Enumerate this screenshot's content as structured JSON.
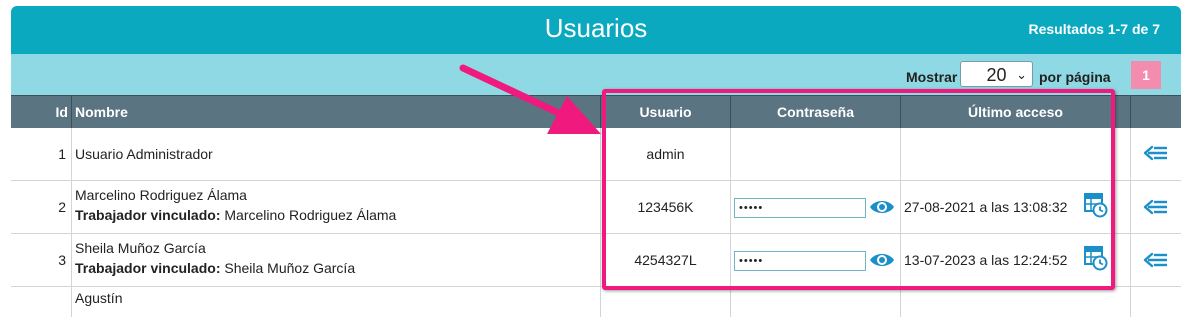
{
  "header": {
    "title": "Usuarios",
    "results": "Resultados 1-7 de 7"
  },
  "toolbar": {
    "show_label": "Mostrar",
    "page_size": "20",
    "per_page_label": "por página",
    "current_page": "1"
  },
  "columns": [
    "Id",
    "Nombre",
    "Usuario",
    "Contraseña",
    "Último acceso"
  ],
  "rows": [
    {
      "id": "1",
      "name": "Usuario Administrador",
      "worker_label": "",
      "worker_name": "",
      "username": "admin",
      "password": "",
      "last_access": ""
    },
    {
      "id": "2",
      "name": "Marcelino Rodriguez Álama",
      "worker_label": "Trabajador vinculado:",
      "worker_name": "Marcelino Rodriguez Álama",
      "username": "123456K",
      "password": "•••••",
      "last_access": "27-08-2021 a las 13:08:32"
    },
    {
      "id": "3",
      "name": "Sheila Muñoz García",
      "worker_label": "Trabajador vinculado:",
      "worker_name": "Sheila Muñoz García",
      "username": "4254327L",
      "password": "•••••",
      "last_access": "13-07-2023 a las 12:24:52"
    },
    {
      "id": "",
      "name": "Agustín",
      "worker_label": "",
      "worker_name": "",
      "username": "",
      "password": "",
      "last_access": ""
    }
  ],
  "colors": {
    "header_bg": "#0aa9bf",
    "toolbar_bg": "#8ed9e3",
    "table_head_bg": "#5a7482",
    "accent_icon": "#1a8fc9",
    "highlight": "#f0197d",
    "page_button": "#f48cb0"
  },
  "icons": [
    "eye-icon",
    "calendar-clock-icon",
    "back-arrow-icon",
    "annotation-arrow"
  ]
}
